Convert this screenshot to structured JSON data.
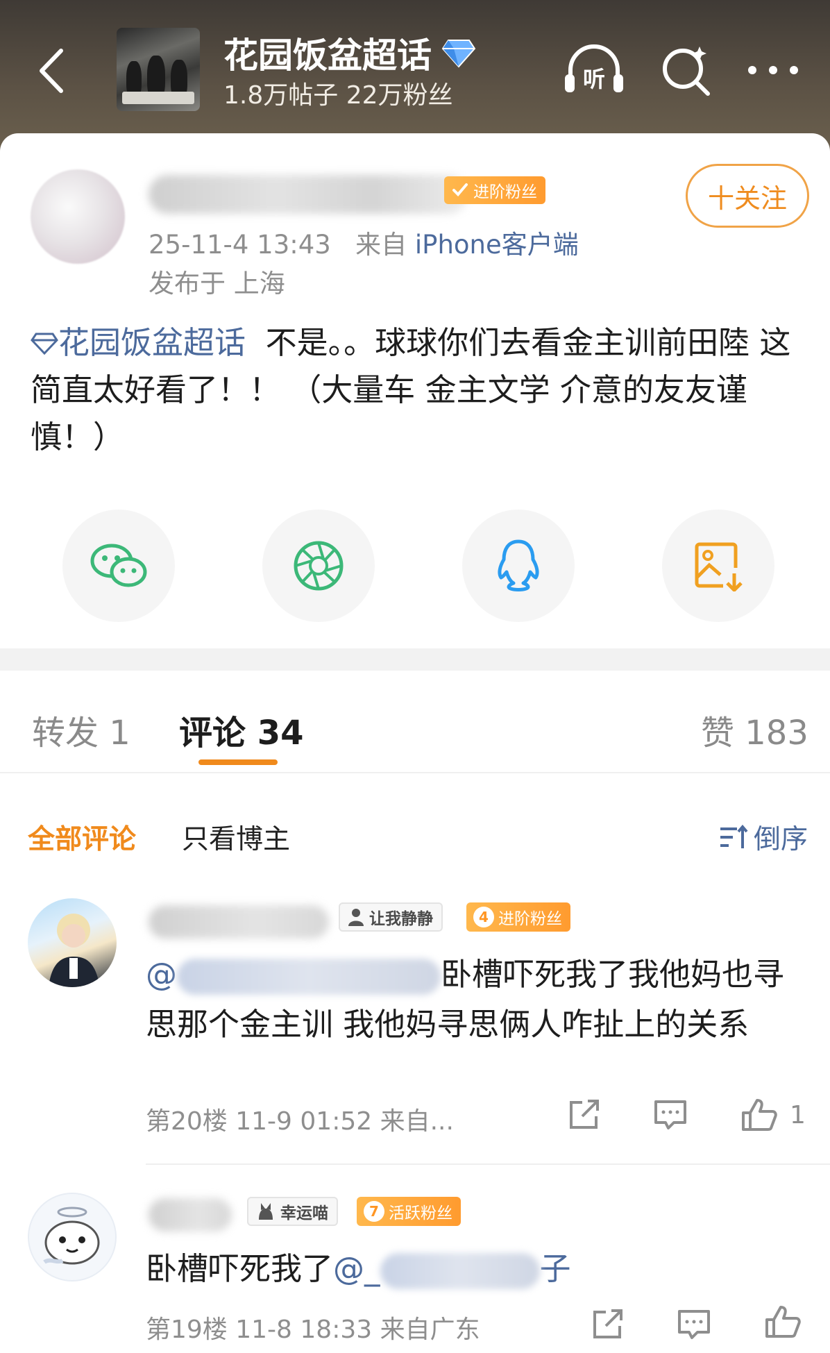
{
  "header": {
    "title": "花园饭盆超话",
    "subtitle": "1.8万帖子 22万粉丝",
    "icons": [
      "back-icon",
      "super-topic-diamond-icon",
      "listen-icon",
      "search-icon",
      "more-icon"
    ],
    "listen_label": "听"
  },
  "post": {
    "fan_badge": "进阶粉丝",
    "follow_label": "十关注",
    "timestamp": "25-11-4 13:43",
    "source_prefix": "来自",
    "source": "iPhone客户端",
    "location": "发布于 上海",
    "topic": "花园饭盆超话",
    "body": "  不是。。球球你们去看金主训前田陸 这简直太好看了！！ （大量车 金主文学 介意的友友谨慎！）",
    "share_icons": [
      "wechat-icon",
      "moments-icon",
      "qq-icon",
      "save-image-icon"
    ]
  },
  "tabs": {
    "repost": "转发 1",
    "comments": "评论 34",
    "likes": "赞 183"
  },
  "filters": {
    "all": "全部评论",
    "author_only": "只看博主",
    "sort": "倒序"
  },
  "comments": [
    {
      "badge_gray": "让我静静",
      "fan_level": "4",
      "fan_badge": "进阶粉丝",
      "text_prefix": "@",
      "text": "卧槽吓死我了我他妈也寻思那个金主训 我他妈寻思俩人咋扯上的关系",
      "meta": "第20楼 11-9 01:52 来自...",
      "likes": "1"
    },
    {
      "badge_gray": "幸运喵",
      "fan_level": "7",
      "fan_badge": "活跃粉丝",
      "text": "卧槽吓死我了",
      "mention_prefix": "@_",
      "mention_suffix": "子",
      "meta": "第19楼 11-8 18:33 来自广东"
    }
  ],
  "colors": {
    "accent_orange": "#f08a1c",
    "link_blue": "#4c6a9c",
    "badge_orange": "#ff9b2f"
  }
}
